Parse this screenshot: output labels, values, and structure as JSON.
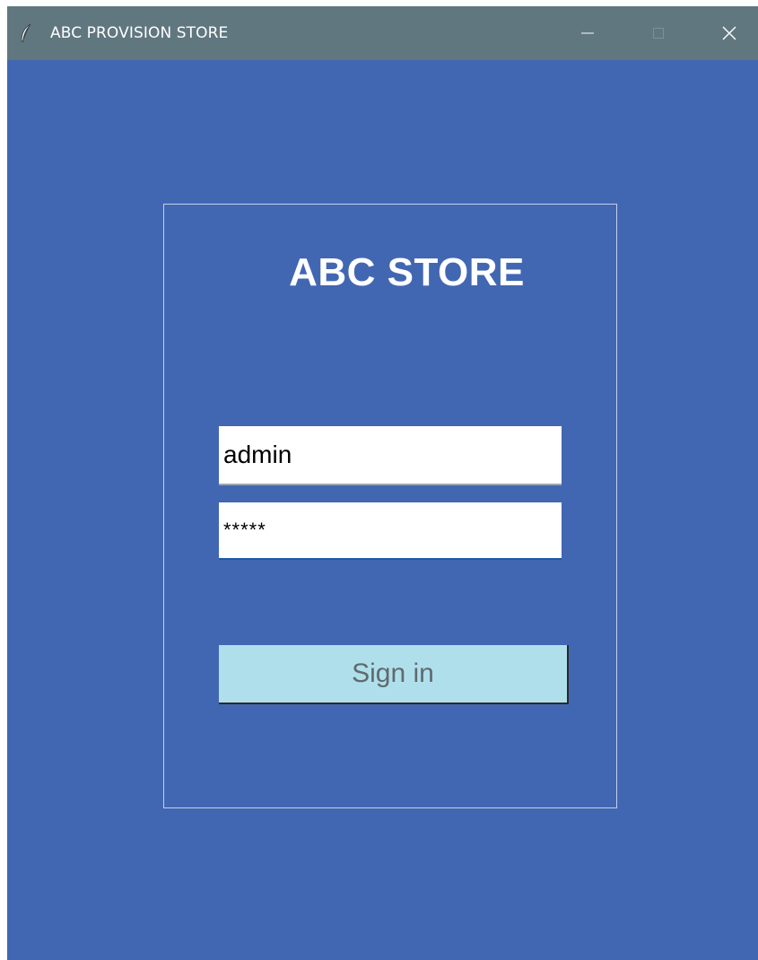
{
  "window": {
    "title": "ABC PROVISION STORE",
    "icon": "feather-icon",
    "controls": [
      "minimize-icon",
      "maximize-icon",
      "close-icon"
    ]
  },
  "login": {
    "store_title": "ABC STORE",
    "username_value": "admin",
    "password_display": "*****",
    "sign_in_label": "Sign in"
  },
  "colors": {
    "background": "#4267b2",
    "titlebar": "#60777f",
    "button": "#b0dfec",
    "button_text": "#5f6a6d",
    "frame_border": "#c2d0ea"
  }
}
